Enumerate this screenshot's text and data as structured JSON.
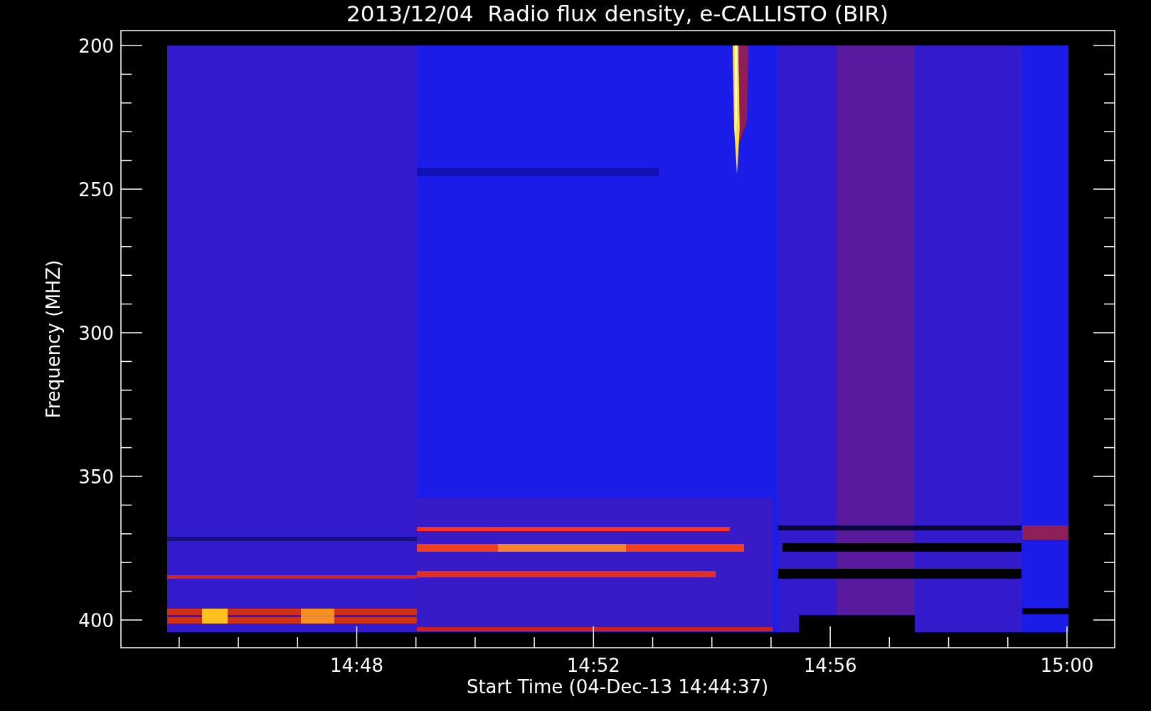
{
  "title": "2013/12/04  Radio flux density, e-CALLISTO (BIR)",
  "y_axis": {
    "label": "Frequency (MHZ)",
    "ticks": [
      "200",
      "250",
      "300",
      "350",
      "400"
    ]
  },
  "x_axis": {
    "label": "Start Time (04-Dec-13 14:44:37)",
    "ticks": [
      "14:48",
      "14:52",
      "14:56",
      "15:00"
    ]
  }
}
